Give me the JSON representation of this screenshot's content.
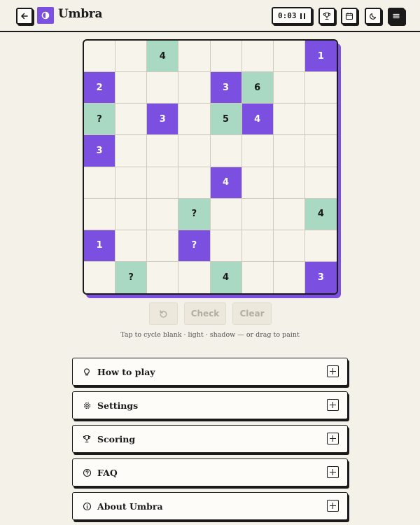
{
  "header": {
    "brand": "Umbra",
    "timer": "0:03",
    "icons": {
      "back": "arrow-left-icon",
      "logo": "half-circle-icon",
      "pause": "pause-icon",
      "leaderboard": "trophy-icon",
      "archive": "calendar-icon",
      "theme": "moon-icon",
      "menu": "hamburger-icon"
    }
  },
  "colors": {
    "shadow": "#7b4fe0",
    "light": "#a9d8c3",
    "background": "#f4f1e9",
    "ink": "#1a1a1a"
  },
  "board": {
    "size": 8,
    "rows": [
      [
        {
          "s": "e",
          "v": ""
        },
        {
          "s": "e",
          "v": ""
        },
        {
          "s": "l",
          "v": "4"
        },
        {
          "s": "e",
          "v": ""
        },
        {
          "s": "e",
          "v": ""
        },
        {
          "s": "e",
          "v": ""
        },
        {
          "s": "e",
          "v": ""
        },
        {
          "s": "d",
          "v": "1"
        }
      ],
      [
        {
          "s": "d",
          "v": "2"
        },
        {
          "s": "e",
          "v": ""
        },
        {
          "s": "e",
          "v": ""
        },
        {
          "s": "e",
          "v": ""
        },
        {
          "s": "d",
          "v": "3"
        },
        {
          "s": "l",
          "v": "6"
        },
        {
          "s": "e",
          "v": ""
        },
        {
          "s": "e",
          "v": ""
        }
      ],
      [
        {
          "s": "l",
          "v": "?"
        },
        {
          "s": "e",
          "v": ""
        },
        {
          "s": "d",
          "v": "3"
        },
        {
          "s": "e",
          "v": ""
        },
        {
          "s": "l",
          "v": "5"
        },
        {
          "s": "d",
          "v": "4"
        },
        {
          "s": "e",
          "v": ""
        },
        {
          "s": "e",
          "v": ""
        }
      ],
      [
        {
          "s": "d",
          "v": "3"
        },
        {
          "s": "e",
          "v": ""
        },
        {
          "s": "e",
          "v": ""
        },
        {
          "s": "e",
          "v": ""
        },
        {
          "s": "e",
          "v": ""
        },
        {
          "s": "e",
          "v": ""
        },
        {
          "s": "e",
          "v": ""
        },
        {
          "s": "e",
          "v": ""
        }
      ],
      [
        {
          "s": "e",
          "v": ""
        },
        {
          "s": "e",
          "v": ""
        },
        {
          "s": "e",
          "v": ""
        },
        {
          "s": "e",
          "v": ""
        },
        {
          "s": "d",
          "v": "4"
        },
        {
          "s": "e",
          "v": ""
        },
        {
          "s": "e",
          "v": ""
        },
        {
          "s": "e",
          "v": ""
        }
      ],
      [
        {
          "s": "e",
          "v": ""
        },
        {
          "s": "e",
          "v": ""
        },
        {
          "s": "e",
          "v": ""
        },
        {
          "s": "l",
          "v": "?"
        },
        {
          "s": "e",
          "v": ""
        },
        {
          "s": "e",
          "v": ""
        },
        {
          "s": "e",
          "v": ""
        },
        {
          "s": "l",
          "v": "4"
        }
      ],
      [
        {
          "s": "d",
          "v": "1"
        },
        {
          "s": "e",
          "v": ""
        },
        {
          "s": "e",
          "v": ""
        },
        {
          "s": "d",
          "v": "?"
        },
        {
          "s": "e",
          "v": ""
        },
        {
          "s": "e",
          "v": ""
        },
        {
          "s": "e",
          "v": ""
        },
        {
          "s": "e",
          "v": ""
        }
      ],
      [
        {
          "s": "e",
          "v": ""
        },
        {
          "s": "l",
          "v": "?"
        },
        {
          "s": "e",
          "v": ""
        },
        {
          "s": "e",
          "v": ""
        },
        {
          "s": "l",
          "v": "4"
        },
        {
          "s": "e",
          "v": ""
        },
        {
          "s": "e",
          "v": ""
        },
        {
          "s": "d",
          "v": "3"
        }
      ]
    ]
  },
  "controls": {
    "undo_icon": "undo-icon",
    "check_label": "Check",
    "clear_label": "Clear"
  },
  "hint": "Tap to cycle blank · light · shadow — or drag to paint",
  "sections": [
    {
      "label": "How to play",
      "icon": "lightbulb-icon"
    },
    {
      "label": "Settings",
      "icon": "gear-icon"
    },
    {
      "label": "Scoring",
      "icon": "trophy-icon"
    },
    {
      "label": "FAQ",
      "icon": "question-circle-icon"
    },
    {
      "label": "About Umbra",
      "icon": "info-circle-icon"
    }
  ]
}
